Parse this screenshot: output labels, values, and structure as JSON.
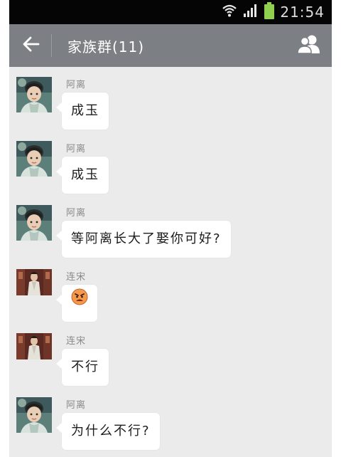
{
  "status_bar": {
    "time": "21:54",
    "icons": [
      "wifi-icon",
      "signal-icon",
      "battery-icon"
    ],
    "battery_color": "#8fd14f"
  },
  "header": {
    "title": "家族群(11)",
    "back_icon": "back-arrow-icon",
    "members_icon": "group-members-icon"
  },
  "messages": [
    {
      "sender": "阿离",
      "text": "成玉",
      "avatar": "avatar-ali"
    },
    {
      "sender": "阿离",
      "text": "成玉",
      "avatar": "avatar-ali"
    },
    {
      "sender": "阿离",
      "text": "等阿离长大了娶你可好?",
      "avatar": "avatar-ali"
    },
    {
      "sender": "连宋",
      "text": "",
      "emoji": "angry-face-emoji",
      "avatar": "avatar-liansong"
    },
    {
      "sender": "连宋",
      "text": "不行",
      "avatar": "avatar-liansong"
    },
    {
      "sender": "阿离",
      "text": "为什么不行?",
      "avatar": "avatar-ali"
    }
  ],
  "colors": {
    "app_bar": "#7c7f84",
    "chat_bg": "#ebebeb",
    "bubble": "#ffffff"
  }
}
